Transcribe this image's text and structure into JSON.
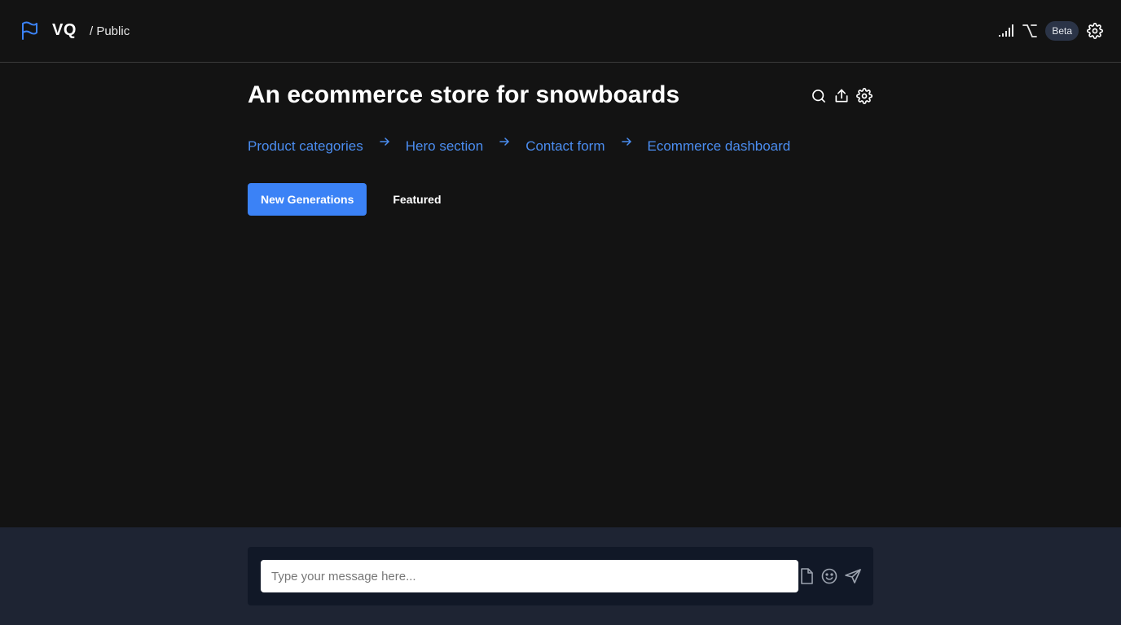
{
  "header": {
    "brand": "VQ",
    "breadcrumb": "/ Public",
    "badge": "Beta",
    "icons": [
      "flag-icon",
      "signal-icon",
      "option-key-icon",
      "gear-icon"
    ]
  },
  "main": {
    "title": "An ecommerce store for snowboards",
    "title_actions": [
      "search-icon",
      "share-icon",
      "gear-icon"
    ],
    "suggestions": [
      "Product categories",
      "Hero section",
      "Contact form",
      "Ecommerce dashboard"
    ],
    "tabs": {
      "active": "New Generations",
      "other": "Featured"
    }
  },
  "composer": {
    "placeholder": "Type your message here...",
    "value": "",
    "actions": [
      "file-icon",
      "emoji-icon",
      "send-icon"
    ]
  },
  "colors": {
    "background": "#131313",
    "accent": "#3b82f6",
    "link": "#4b8df0",
    "footer": "#1e2433",
    "composer": "#111827"
  }
}
